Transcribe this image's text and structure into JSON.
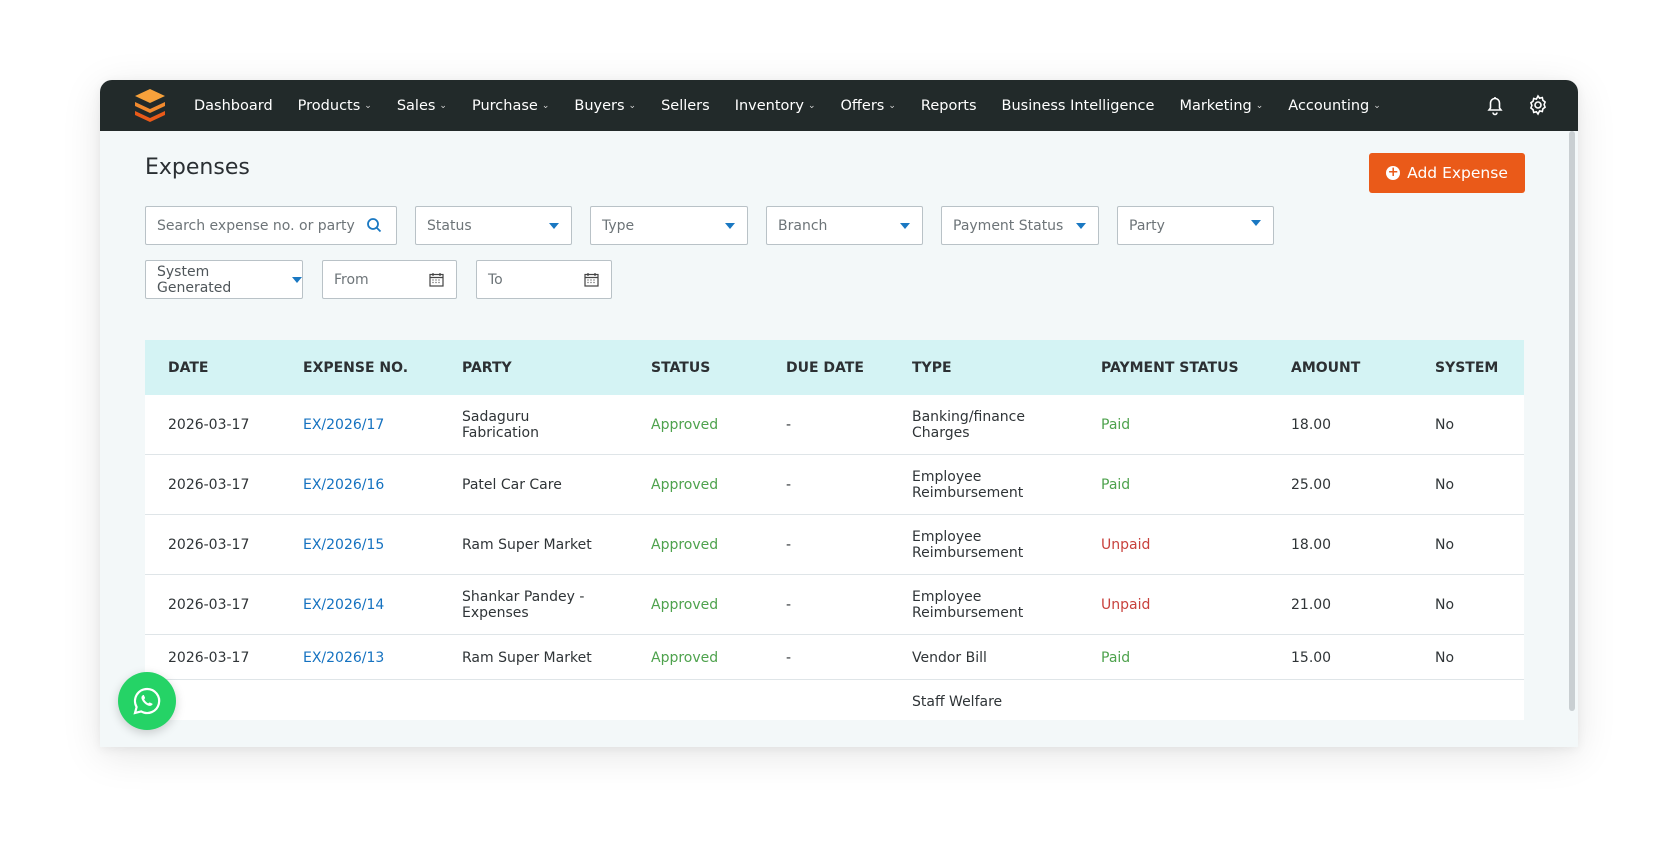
{
  "nav": {
    "items": [
      {
        "label": "Dashboard",
        "dropdown": false
      },
      {
        "label": "Products",
        "dropdown": true
      },
      {
        "label": "Sales",
        "dropdown": true
      },
      {
        "label": "Purchase",
        "dropdown": true
      },
      {
        "label": "Buyers",
        "dropdown": true
      },
      {
        "label": "Sellers",
        "dropdown": false
      },
      {
        "label": "Inventory",
        "dropdown": true
      },
      {
        "label": "Offers",
        "dropdown": true
      },
      {
        "label": "Reports",
        "dropdown": false
      },
      {
        "label": "Business Intelligence",
        "dropdown": false
      },
      {
        "label": "Marketing",
        "dropdown": true
      },
      {
        "label": "Accounting",
        "dropdown": true
      }
    ],
    "icons": [
      "logo-icon",
      "bell-icon",
      "gear-icon"
    ]
  },
  "page": {
    "title": "Expenses",
    "add_button": "Add Expense"
  },
  "filters": {
    "search_placeholder": "Search expense no. or party",
    "status": "Status",
    "type": "Type",
    "branch": "Branch",
    "payment_status": "Payment Status",
    "party": "Party",
    "system_generated": "System Generated",
    "from": "From",
    "to": "To"
  },
  "table": {
    "columns": [
      "DATE",
      "EXPENSE NO.",
      "PARTY",
      "STATUS",
      "DUE DATE",
      "TYPE",
      "PAYMENT STATUS",
      "AMOUNT",
      "SYSTEM"
    ],
    "rows": [
      {
        "date": "2026-03-17",
        "expense_no": "EX/2026/17",
        "party": [
          "Sadaguru",
          "Fabrication"
        ],
        "status": "Approved",
        "due_date": "-",
        "type": [
          "Banking/finance",
          "Charges"
        ],
        "payment_status": "Paid",
        "amount": "18.00",
        "system": "No"
      },
      {
        "date": "2026-03-17",
        "expense_no": "EX/2026/16",
        "party": [
          "Patel Car Care"
        ],
        "status": "Approved",
        "due_date": "-",
        "type": [
          "Employee",
          "Reimbursement"
        ],
        "payment_status": "Paid",
        "amount": "25.00",
        "system": "No"
      },
      {
        "date": "2026-03-17",
        "expense_no": "EX/2026/15",
        "party": [
          "Ram Super Market"
        ],
        "status": "Approved",
        "due_date": "-",
        "type": [
          "Employee",
          "Reimbursement"
        ],
        "payment_status": "Unpaid",
        "amount": "18.00",
        "system": "No"
      },
      {
        "date": "2026-03-17",
        "expense_no": "EX/2026/14",
        "party": [
          "Shankar Pandey -",
          "Expenses"
        ],
        "status": "Approved",
        "due_date": "-",
        "type": [
          "Employee",
          "Reimbursement"
        ],
        "payment_status": "Unpaid",
        "amount": "21.00",
        "system": "No"
      },
      {
        "date": "2026-03-17",
        "expense_no": "EX/2026/13",
        "party": [
          "Ram Super Market"
        ],
        "status": "Approved",
        "due_date": "-",
        "type": [
          "Vendor Bill"
        ],
        "payment_status": "Paid",
        "amount": "15.00",
        "system": "No"
      },
      {
        "date": "",
        "expense_no": "",
        "party": [
          ""
        ],
        "status": "",
        "due_date": "",
        "type": [
          "Staff Welfare"
        ],
        "payment_status": "",
        "amount": "",
        "system": ""
      }
    ]
  },
  "colors": {
    "navbar": "#222a2a",
    "accent_orange": "#ea5a19",
    "table_header": "#d4f3f4",
    "link_blue": "#1572c0",
    "paid_green": "#4ea24d",
    "unpaid_red": "#c8413c",
    "whatsapp": "#25d366"
  }
}
